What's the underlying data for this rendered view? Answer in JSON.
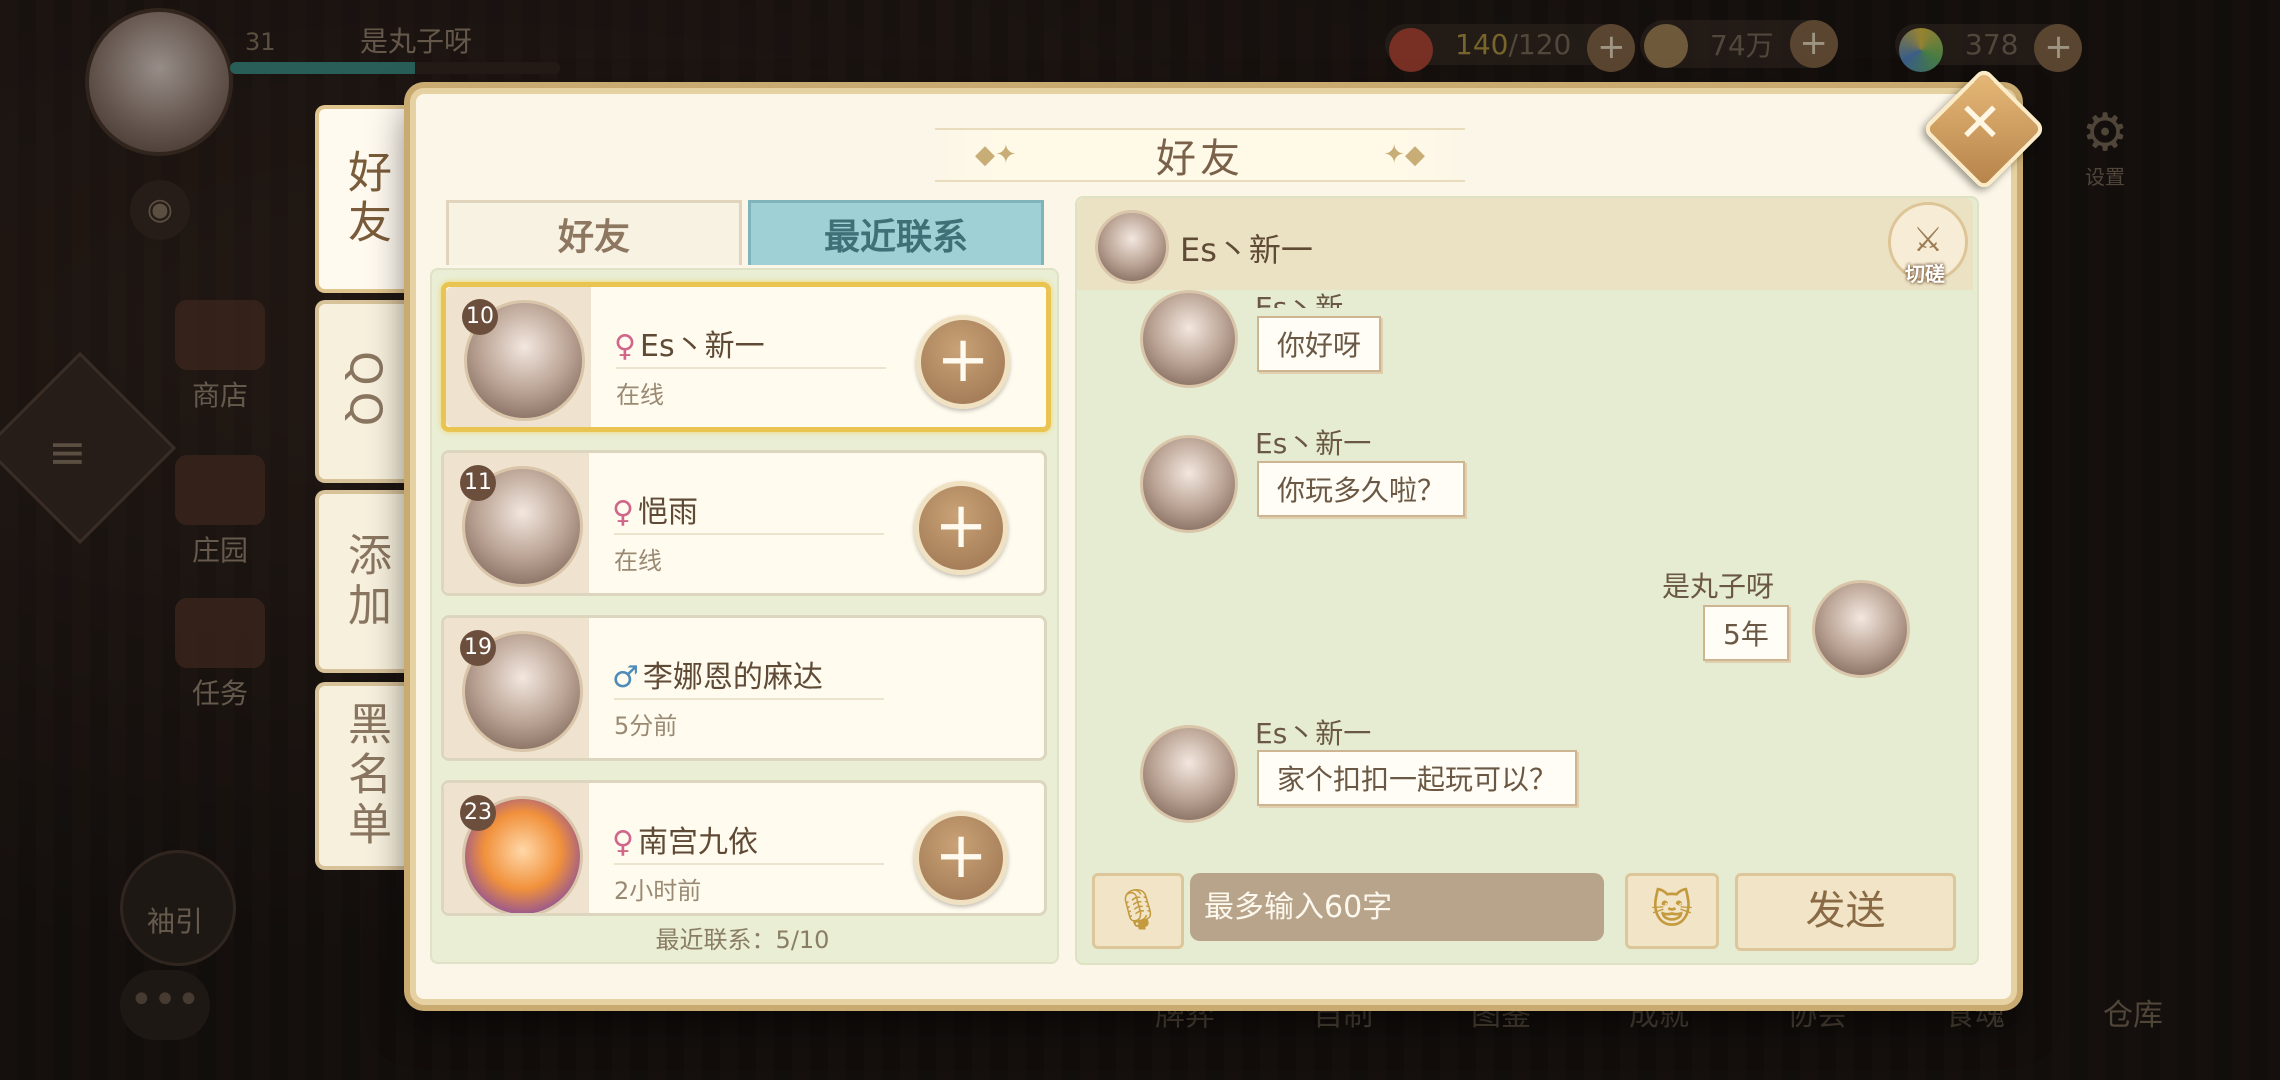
{
  "player": {
    "level": "31",
    "name": "是丸子呀",
    "exp_fraction": 0.56
  },
  "resources": [
    {
      "icon": "bowl-icon",
      "value_highlight": "140",
      "value_rest": "/120"
    },
    {
      "icon": "leaf-coin-icon",
      "value_highlight": "",
      "value_rest": "74万"
    },
    {
      "icon": "gem-icon",
      "value_highlight": "",
      "value_rest": "378"
    }
  ],
  "side_nav": [
    "商店",
    "庄园",
    "任务",
    "袖引"
  ],
  "bottom_nav": [
    "牌弈",
    "自制",
    "图鉴",
    "成就",
    "协会",
    "食魂",
    "仓库"
  ],
  "settings_label": "设置",
  "dialog": {
    "title": "好友"
  },
  "vertical_tabs": [
    "好友",
    "QQ",
    "添加",
    "黑名单"
  ],
  "list_tabs": {
    "friends": "好友",
    "recent": "最近联系"
  },
  "friends": [
    {
      "level": "10",
      "gender": "♀",
      "name": "Es丶新一",
      "status": "在线",
      "has_add": true
    },
    {
      "level": "11",
      "gender": "♀",
      "name": "悒雨",
      "status": "在线",
      "has_add": true
    },
    {
      "level": "19",
      "gender": "♂",
      "name": "李娜恩的麻达",
      "status": "5分前",
      "has_add": false
    },
    {
      "level": "23",
      "gender": "♀",
      "name": "南宫九依",
      "status": "2小时前",
      "has_add": true
    }
  ],
  "recent_count": "最近联系：5/10",
  "chat": {
    "partner": "Es丶新一",
    "duel_label": "切磋",
    "messages": [
      {
        "from": "Es丶新一",
        "text": "你好呀",
        "side": "left",
        "name_cut": "Es丶新"
      },
      {
        "from": "Es丶新一",
        "text": "你玩多久啦？",
        "side": "left"
      },
      {
        "from": "是丸子呀",
        "text": "5年",
        "side": "right"
      },
      {
        "from": "Es丶新一",
        "text": "家个扣扣一起玩可以？",
        "side": "left"
      }
    ],
    "input_placeholder": "最多输入60字",
    "send_label": "发送"
  }
}
